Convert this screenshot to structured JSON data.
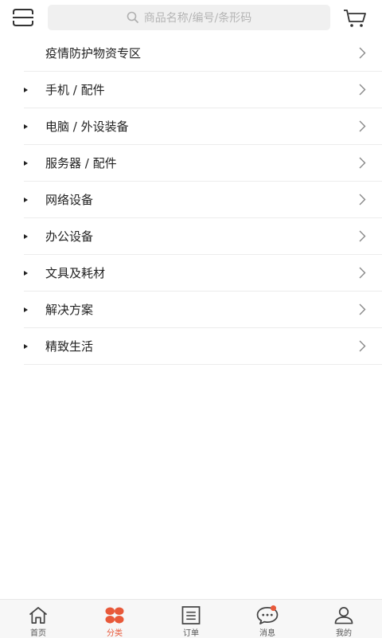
{
  "search": {
    "placeholder": "商品名称/编号/条形码"
  },
  "categories": [
    {
      "label": "疫情防护物资专区",
      "has_bullet": false
    },
    {
      "label": "手机 / 配件",
      "has_bullet": true
    },
    {
      "label": "电脑 / 外设装备",
      "has_bullet": true
    },
    {
      "label": "服务器 /  配件",
      "has_bullet": true
    },
    {
      "label": "网络设备",
      "has_bullet": true
    },
    {
      "label": "办公设备",
      "has_bullet": true
    },
    {
      "label": "文具及耗材",
      "has_bullet": true
    },
    {
      "label": "解决方案",
      "has_bullet": true
    },
    {
      "label": "精致生活",
      "has_bullet": true
    }
  ],
  "tabs": [
    {
      "label": "首页",
      "icon": "home-icon",
      "active": false
    },
    {
      "label": "分类",
      "icon": "category-icon",
      "active": true
    },
    {
      "label": "订单",
      "icon": "order-icon",
      "active": false
    },
    {
      "label": "消息",
      "icon": "message-icon",
      "active": false,
      "badge": true
    },
    {
      "label": "我的",
      "icon": "user-icon",
      "active": false
    }
  ],
  "colors": {
    "accent": "#e8593a",
    "text": "#222222",
    "muted": "#b5b5b5",
    "search_bg": "#f0f0f0"
  }
}
